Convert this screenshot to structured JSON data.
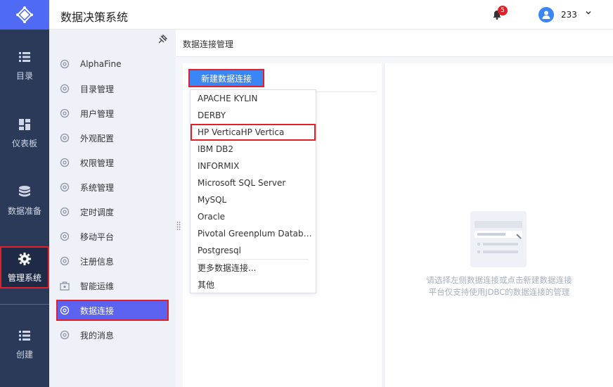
{
  "header": {
    "title": "数据决策系统",
    "notification_count": "5",
    "username": "233"
  },
  "rail": {
    "items": [
      {
        "label": "目录",
        "icon": "list-icon"
      },
      {
        "label": "仪表板",
        "icon": "dashboard-icon"
      },
      {
        "label": "数据准备",
        "icon": "database-icon"
      },
      {
        "label": "管理系统",
        "icon": "gear-icon"
      },
      {
        "label": "创建",
        "icon": "list-icon"
      }
    ]
  },
  "sidebar": {
    "items": [
      {
        "label": "AlphaFine"
      },
      {
        "label": "目录管理"
      },
      {
        "label": "用户管理"
      },
      {
        "label": "外观配置"
      },
      {
        "label": "权限管理"
      },
      {
        "label": "系统管理"
      },
      {
        "label": "定时调度"
      },
      {
        "label": "移动平台"
      },
      {
        "label": "注册信息"
      },
      {
        "label": "智能运维"
      },
      {
        "label": "数据连接"
      },
      {
        "label": "我的消息"
      }
    ]
  },
  "main": {
    "breadcrumb": "数据连接管理",
    "new_button_label": "新建数据连接",
    "dropdown": [
      "APACHE KYLIN",
      "DERBY",
      "HP VerticaHP Vertica",
      "IBM DB2",
      "INFORMIX",
      "Microsoft SQL Server",
      "MySQL",
      "Oracle",
      "Pivotal Greenplum Database",
      "Postgresql",
      "更多数据连接...",
      "其他"
    ],
    "empty_hint_line1": "请选择左侧数据连接或点击新建数据连接",
    "empty_hint_line2": "平台仅支持使用JDBC的数据连接的管理"
  },
  "colors": {
    "rail_bg": "#2c3a5a",
    "accent": "#4f6bf5",
    "button": "#3a86f6",
    "active_item": "#5b63f0",
    "highlight": "#e3202a"
  }
}
